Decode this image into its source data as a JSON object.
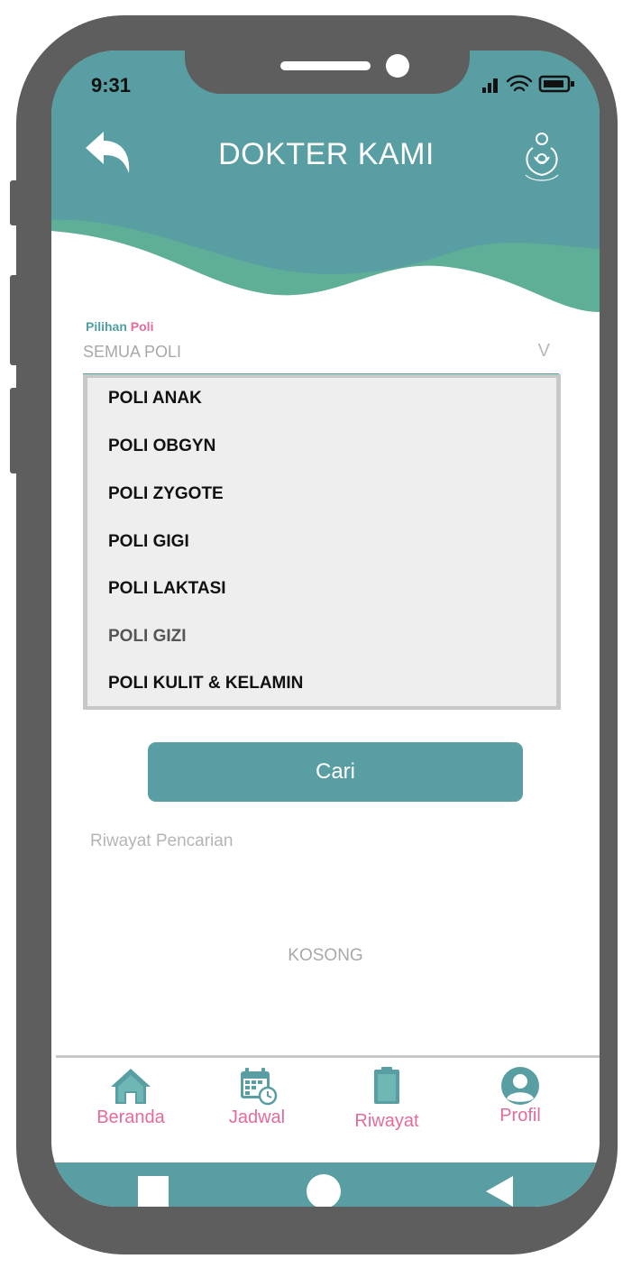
{
  "status_bar": {
    "time": "9:31"
  },
  "header": {
    "title": "DOKTER KAMI"
  },
  "form": {
    "label_part1": "Pilihan",
    "label_part2": "Poli",
    "selected": "SEMUA POLI",
    "chevron": "V",
    "options": [
      "POLI ANAK",
      "POLI OBGYN",
      "POLI ZYGOTE",
      "POLI GIGI",
      "POLI LAKTASI",
      "POLI GIZI",
      "POLI KULIT & KELAMIN"
    ],
    "search_label": "Cari"
  },
  "history": {
    "title": "Riwayat Pencarian",
    "empty": "KOSONG"
  },
  "bottom_nav": {
    "items": [
      {
        "label": "Beranda",
        "icon": "home-icon"
      },
      {
        "label": "Jadwal",
        "icon": "calendar-clock-icon"
      },
      {
        "label": "Riwayat",
        "icon": "clipboard-icon"
      },
      {
        "label": "Profil",
        "icon": "user-icon"
      }
    ]
  },
  "colors": {
    "header_teal": "#589ea2",
    "wave_green": "#5fae97",
    "accent_pink": "#e46b9c",
    "frame": "#5e5e5e"
  }
}
